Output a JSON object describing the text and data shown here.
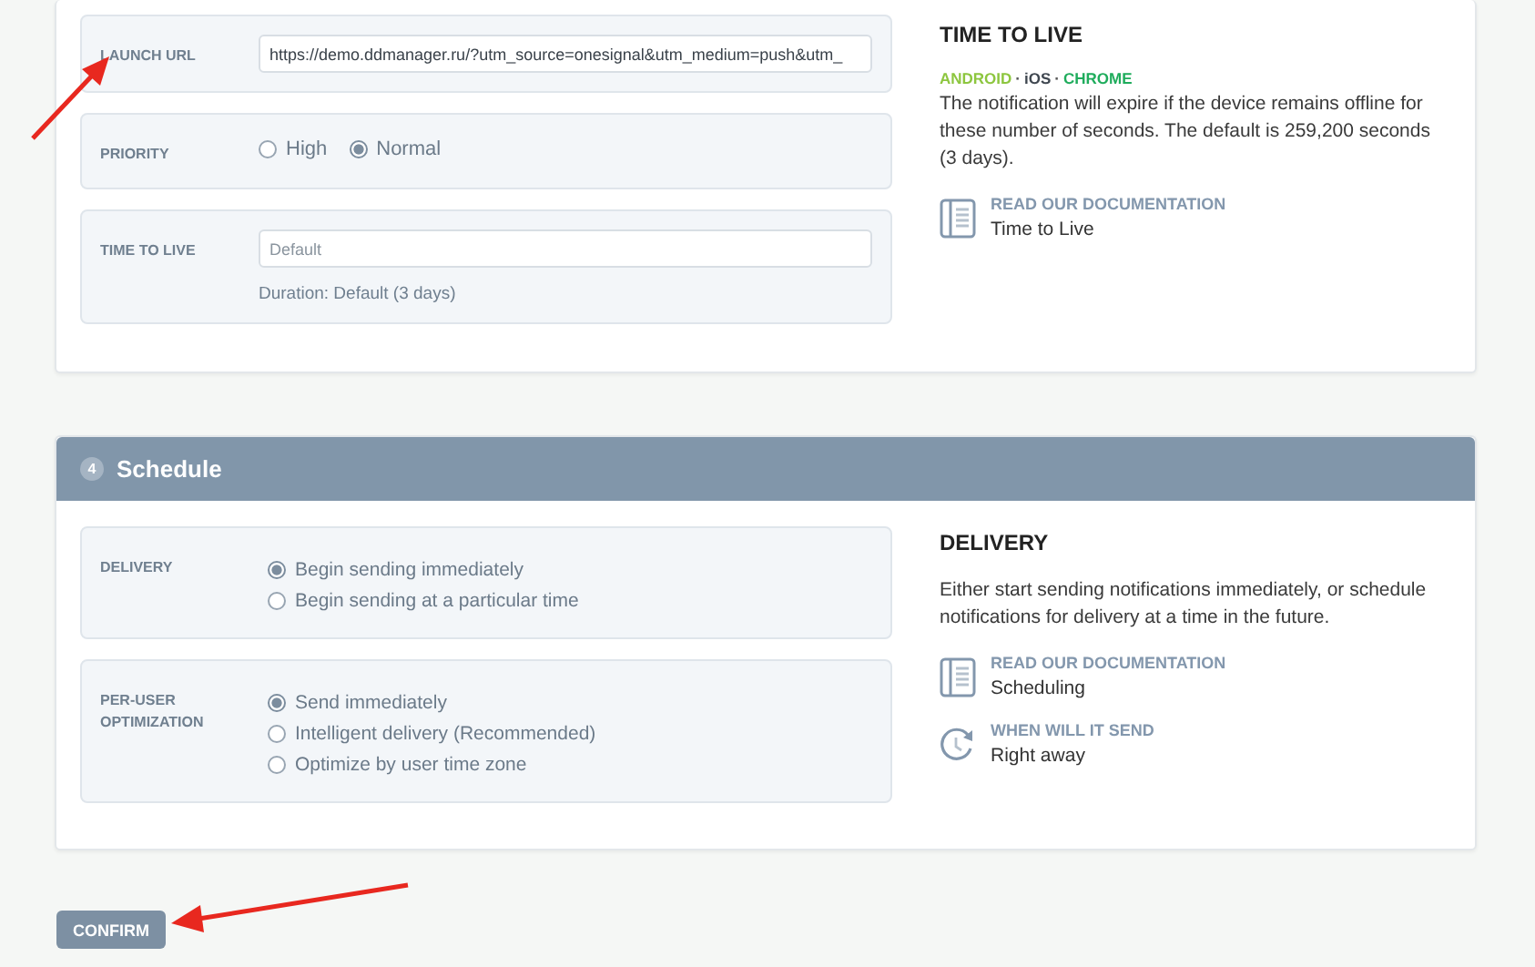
{
  "sections": [
    {
      "fields": [
        {
          "kind": "text",
          "label": "LAUNCH URL",
          "value": "https://demo.ddmanager.ru/?utm_source=onesignal&utm_medium=push&utm_"
        },
        {
          "kind": "radio_row",
          "label": "PRIORITY",
          "options": [
            {
              "label": "High",
              "selected": false
            },
            {
              "label": "Normal",
              "selected": true
            }
          ]
        },
        {
          "kind": "text",
          "label": "TIME TO LIVE",
          "placeholder": "Default",
          "note": "Duration: Default (3 days)"
        }
      ],
      "info": {
        "title": "TIME TO LIVE",
        "separator": "·",
        "platforms": [
          {
            "label": "ANDROID",
            "color": "#8dc63f"
          },
          {
            "label": "iOS",
            "color": "#3f4750"
          },
          {
            "label": "CHROME",
            "color": "#1fac5c"
          }
        ],
        "description": "The notification will expire if the device remains offline for these number of seconds. The default is 259,200 seconds (3 days).",
        "links": [
          {
            "kind": "doc",
            "caption": "READ OUR DOCUMENTATION",
            "value": "Time to Live"
          }
        ]
      }
    },
    {
      "header": {
        "number": "4",
        "title": "Schedule"
      },
      "fields": [
        {
          "kind": "radio_list",
          "label": "DELIVERY",
          "options": [
            {
              "label": "Begin sending immediately",
              "selected": true
            },
            {
              "label": "Begin sending at a particular time",
              "selected": false
            }
          ]
        },
        {
          "kind": "radio_list",
          "label": "PER-USER OPTIMIZATION",
          "options": [
            {
              "label": "Send immediately",
              "selected": true
            },
            {
              "label": "Intelligent delivery (Recommended)",
              "selected": false
            },
            {
              "label": "Optimize by user time zone",
              "selected": false
            }
          ]
        }
      ],
      "info": {
        "title": "DELIVERY",
        "description": "Either start sending notifications immediately, or schedule notifications for delivery at a time in the future.",
        "links": [
          {
            "kind": "doc",
            "caption": "READ OUR DOCUMENTATION",
            "value": "Scheduling"
          },
          {
            "kind": "clock",
            "caption": "WHEN WILL IT SEND",
            "value": "Right away"
          }
        ]
      }
    }
  ],
  "confirm": "CONFIRM"
}
